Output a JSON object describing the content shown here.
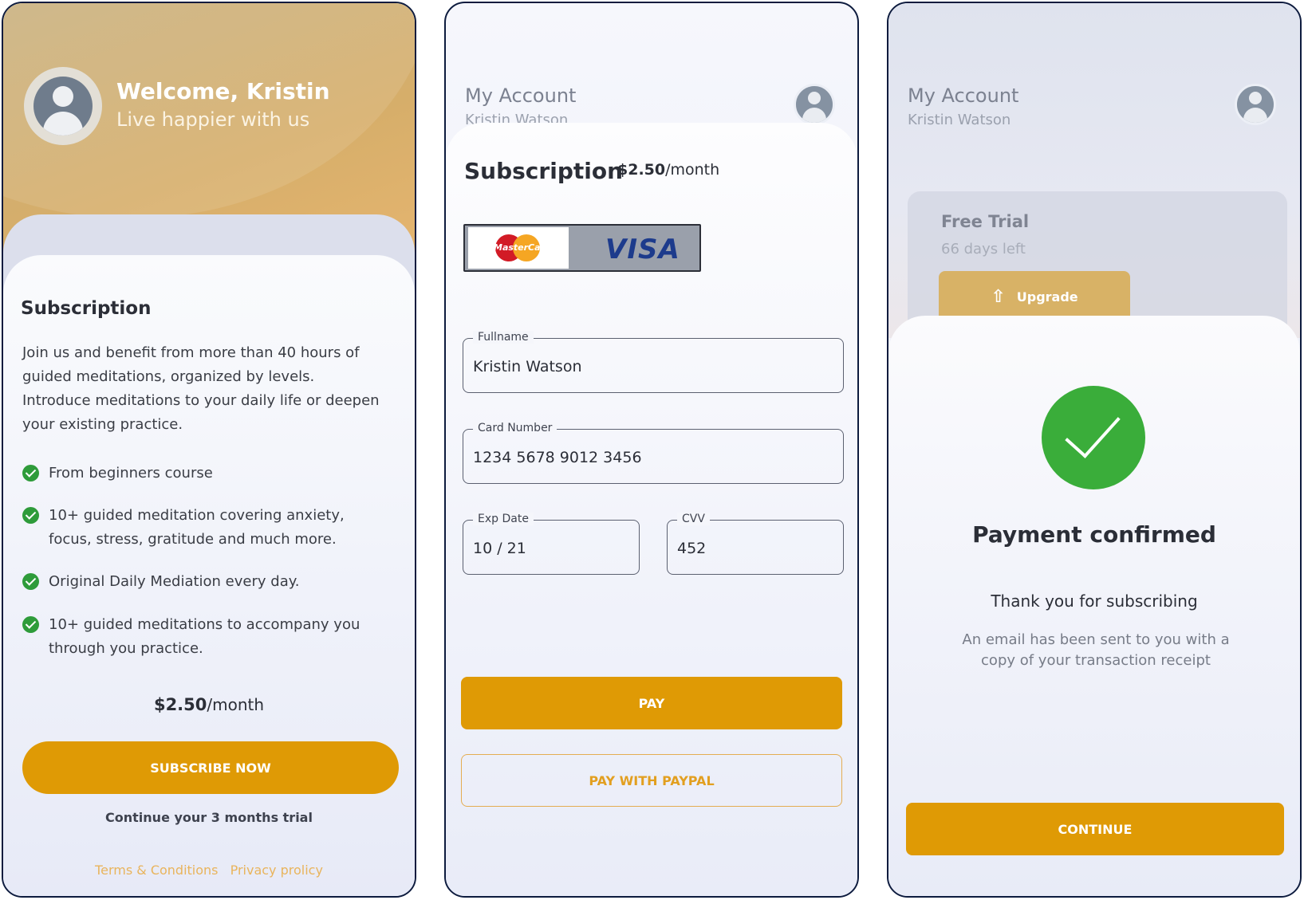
{
  "screen1": {
    "welcome": "Welcome, Kristin",
    "tagline": "Live happier with us",
    "title": "Subscription",
    "description": "Join us and benefit from more than 40 hours of guided meditations, organized by levels. Introduce meditations to your daily life or deepen your existing practice.",
    "features": [
      "From beginners course",
      "10+ guided meditation covering anxiety, focus, stress, gratitude and much more.",
      "Original Daily Mediation every day.",
      "10+ guided meditations to accompany you through you practice."
    ],
    "price": "$2.50",
    "period": "/month",
    "subscribe_label": "SUBSCRIBE NOW",
    "trial_text": "Continue your 3 months trial",
    "terms_link": "Terms & Conditions",
    "privacy_link": "Privacy prolicy"
  },
  "screen2": {
    "header_title": "My Account",
    "header_sub": "Kristin Watson",
    "title": "Subscription",
    "price": "$2.50",
    "period": "/month",
    "card_mastercard": "MasterCard",
    "card_visa": "VISA",
    "fullname_label": "Fullname",
    "fullname_value": "Kristin Watson",
    "card_number_label": "Card Number",
    "card_number_value": "1234 5678 9012 3456",
    "exp_label": "Exp Date",
    "exp_value": "10 / 21",
    "cvv_label": "CVV",
    "cvv_value": "452",
    "pay_label": "PAY",
    "paypal_label": "PAY WITH PAYPAL"
  },
  "screen3": {
    "header_title": "My Account",
    "header_sub": "Kristin Watson",
    "trial_title": "Free Trial",
    "trial_days": "66 days left",
    "upgrade_label": "Upgrade",
    "confirm_title": "Payment confirmed",
    "thank_text": "Thank you for subscribing",
    "email_text": "An email has been sent to you with a copy of your transaction receipt",
    "continue_label": "CONTINUE"
  },
  "colors": {
    "accent": "#df9a05",
    "success": "#3aad3a",
    "frame": "#0d1b3e"
  }
}
